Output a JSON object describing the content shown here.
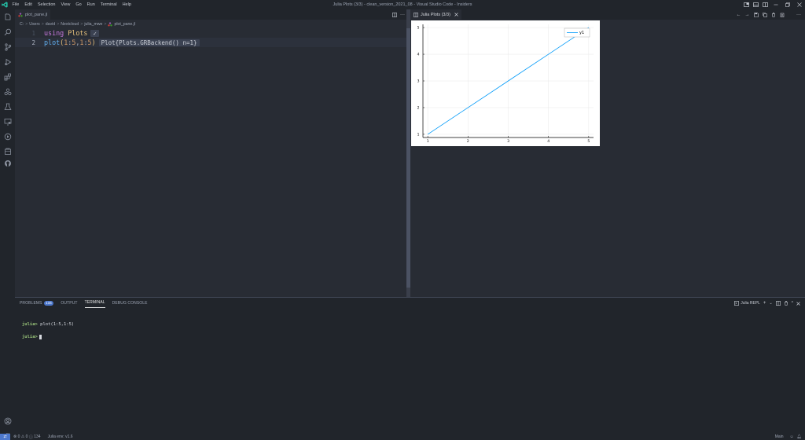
{
  "menu": [
    "File",
    "Edit",
    "Selection",
    "View",
    "Go",
    "Run",
    "Terminal",
    "Help"
  ],
  "window_title": "Julia Plots (3/3) - clean_version_2021_08 - Visual Studio Code - Insiders",
  "editor": {
    "tab_label": "plot_pane.jl",
    "breadcrumb": [
      "C:",
      "Users",
      "david",
      "Nextcloud",
      "julia_mwe",
      "plot_pane.jl"
    ],
    "lines": [
      {
        "number": "1",
        "keyword": "using",
        "module": "Plots",
        "inline": "✓"
      },
      {
        "number": "2",
        "fn": "plot",
        "open": "(",
        "a1": "1",
        "c1": ":",
        "a2": "5",
        "comma": ",",
        "b1": "1",
        "c2": ":",
        "b2": "5",
        "close": ")",
        "inline": "Plot{Plots.GRBackend() n=1}"
      }
    ]
  },
  "plot_pane": {
    "tab_label": "Julia Plots (3/3)"
  },
  "chart_data": {
    "type": "line",
    "x": [
      1,
      2,
      3,
      4,
      5
    ],
    "xticks": [
      "1",
      "2",
      "3",
      "4",
      "5"
    ],
    "yticks": [
      "1",
      "2",
      "3",
      "4",
      "5"
    ],
    "series": [
      {
        "name": "y1",
        "values": [
          1,
          2,
          3,
          4,
          5
        ],
        "color": "#009af9"
      }
    ],
    "xlim": [
      0.88,
      5.12
    ],
    "ylim": [
      0.88,
      5.12
    ],
    "grid": true,
    "legend": "top-right",
    "title": "",
    "xlabel": "",
    "ylabel": ""
  },
  "panel": {
    "tabs": [
      {
        "label": "PROBLEMS",
        "badge": "134"
      },
      {
        "label": "OUTPUT"
      },
      {
        "label": "TERMINAL"
      },
      {
        "label": "DEBUG CONSOLE"
      }
    ],
    "terminal_name": "Julia REPL",
    "terminal_lines": [
      {
        "prompt": "julia>",
        "text": " plot(1:5,1:5)"
      },
      {
        "prompt": "julia>",
        "text": ""
      }
    ]
  },
  "status": {
    "errors": "0",
    "warnings": "0",
    "infos": "134",
    "env": "Julia env: v1.6",
    "main": "Main"
  },
  "colors": {
    "accent": "#4d78cc",
    "prompt": "#98c379"
  }
}
